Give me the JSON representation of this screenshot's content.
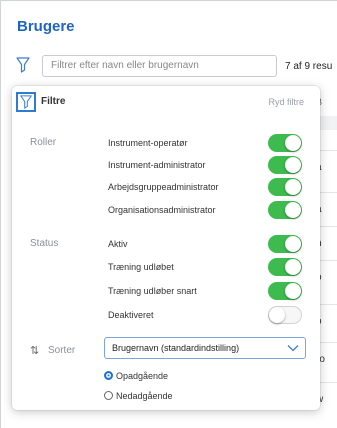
{
  "page": {
    "title": "Brugere"
  },
  "toolbar": {
    "search_placeholder": "Filtrer efter navn eller brugernavn",
    "result_count": "7 af 9 resu"
  },
  "background_table": {
    "header": "B",
    "rows": [
      "a",
      "a",
      "n",
      "o",
      "o",
      "ro",
      "w"
    ]
  },
  "filters": {
    "title": "Filtre",
    "clear_label": "Ryd filtre",
    "roles": {
      "label": "Roller",
      "items": [
        {
          "label": "Instrument-operatør",
          "on": true
        },
        {
          "label": "Instrument-administrator",
          "on": true
        },
        {
          "label": "Arbejdsgruppeadministrator",
          "on": true
        },
        {
          "label": "Organisationsadministrator",
          "on": true
        }
      ]
    },
    "status": {
      "label": "Status",
      "items": [
        {
          "label": "Aktiv",
          "on": true
        },
        {
          "label": "Træning udløbet",
          "on": true
        },
        {
          "label": "Træning udløber snart",
          "on": true
        },
        {
          "label": "Deaktiveret",
          "on": false
        }
      ]
    },
    "sort": {
      "icon": "sort-arrows-icon",
      "label": "Sorter",
      "selected": "Brugernavn (standardindstilling)",
      "orders": [
        {
          "label": "Opadgående",
          "selected": true
        },
        {
          "label": "Nedadgående",
          "selected": false
        }
      ]
    }
  },
  "colors": {
    "accent": "#1f66c1",
    "toggle_on": "#3dbb4e"
  }
}
